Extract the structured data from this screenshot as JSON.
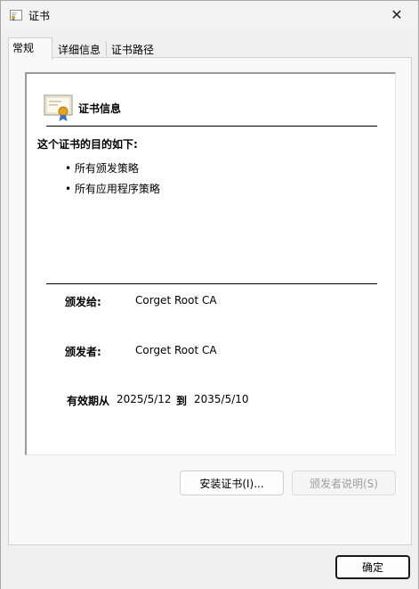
{
  "window": {
    "title": "证书",
    "close_glyph": "✕"
  },
  "tabs": [
    {
      "label": "常规"
    },
    {
      "label": "详细信息"
    },
    {
      "label": "证书路径"
    }
  ],
  "certificate": {
    "header": "证书信息",
    "purpose_title": "这个证书的目的如下:",
    "purposes": [
      "• 所有颁发策略",
      "• 所有应用程序策略"
    ],
    "issued_to_label": "颁发给:",
    "issued_to_value": "Corget Root CA",
    "issued_by_label": "颁发者:",
    "issued_by_value": "Corget Root CA",
    "validity_label": "有效期从",
    "valid_from": "2025/5/12",
    "validity_to_label": "到",
    "valid_to": "2035/5/10"
  },
  "buttons": {
    "install": "安装证书(I)...",
    "issuer_statement": "颁发者说明(S)",
    "ok": "确定"
  },
  "icons": {
    "title_icon": "certificate-icon",
    "cert_icon": "certificate-icon",
    "close_icon": "close-icon"
  },
  "colors": {
    "seal_gold": "#e2a21b",
    "ribbon_blue": "#3c6fc2",
    "panel_border": "#d0d0d0"
  }
}
